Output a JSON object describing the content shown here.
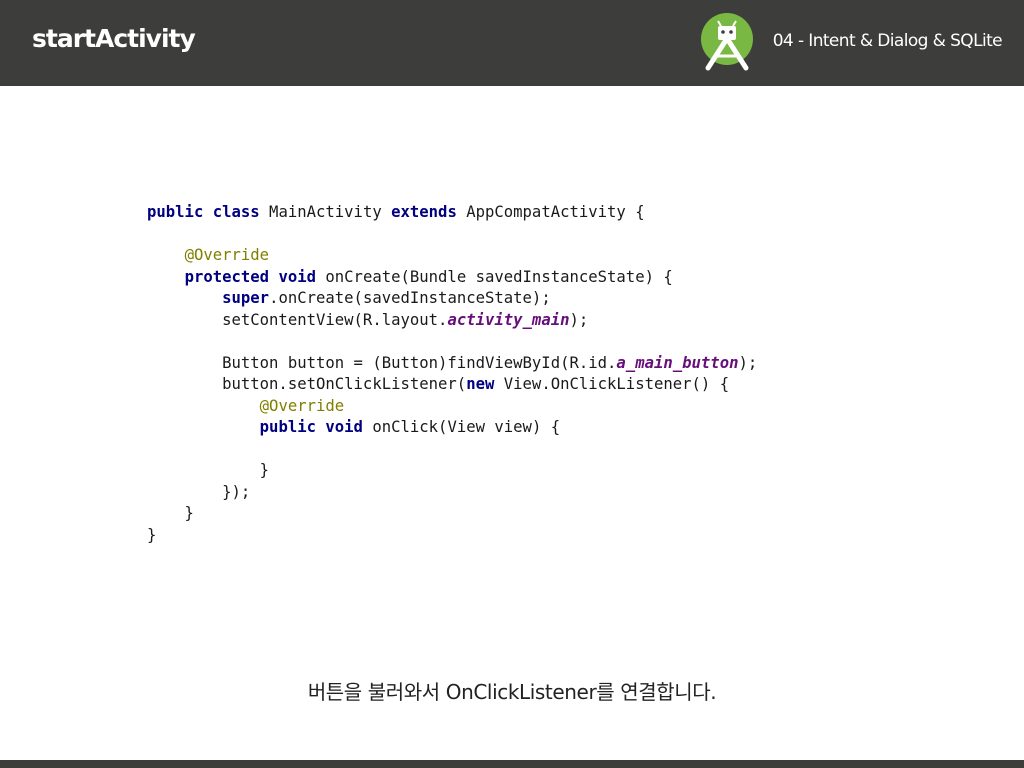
{
  "header": {
    "title": "startActivity",
    "subtitle": "04 - Intent & Dialog & SQLite",
    "logo_icon": "android-studio-logo-icon"
  },
  "code": {
    "lines": [
      [
        {
          "t": "public class",
          "c": "kw"
        },
        {
          "t": " MainActivity ",
          "c": ""
        },
        {
          "t": "extends",
          "c": "kw"
        },
        {
          "t": " AppCompatActivity {",
          "c": ""
        }
      ],
      [],
      [
        {
          "t": "    ",
          "c": ""
        },
        {
          "t": "@Override",
          "c": "ann"
        }
      ],
      [
        {
          "t": "    ",
          "c": ""
        },
        {
          "t": "protected void",
          "c": "kw"
        },
        {
          "t": " onCreate(Bundle savedInstanceState) {",
          "c": ""
        }
      ],
      [
        {
          "t": "        ",
          "c": ""
        },
        {
          "t": "super",
          "c": "kw"
        },
        {
          "t": ".onCreate(savedInstanceState);",
          "c": ""
        }
      ],
      [
        {
          "t": "        setContentView(R.layout.",
          "c": ""
        },
        {
          "t": "activity_main",
          "c": "fld"
        },
        {
          "t": ");",
          "c": ""
        }
      ],
      [],
      [
        {
          "t": "        Button button = (Button)findViewById(R.id.",
          "c": ""
        },
        {
          "t": "a_main_button",
          "c": "fld"
        },
        {
          "t": ");",
          "c": ""
        }
      ],
      [
        {
          "t": "        button.setOnClickListener(",
          "c": ""
        },
        {
          "t": "new",
          "c": "kw"
        },
        {
          "t": " View.OnClickListener() {",
          "c": ""
        }
      ],
      [
        {
          "t": "            ",
          "c": ""
        },
        {
          "t": "@Override",
          "c": "ann"
        }
      ],
      [
        {
          "t": "            ",
          "c": ""
        },
        {
          "t": "public void",
          "c": "kw"
        },
        {
          "t": " onClick(View view) {",
          "c": ""
        }
      ],
      [],
      [
        {
          "t": "            }",
          "c": ""
        }
      ],
      [
        {
          "t": "        });",
          "c": ""
        }
      ],
      [
        {
          "t": "    }",
          "c": ""
        }
      ],
      [
        {
          "t": "}",
          "c": ""
        }
      ]
    ]
  },
  "caption": "버튼을 불러와서 OnClickListener를 연결합니다."
}
